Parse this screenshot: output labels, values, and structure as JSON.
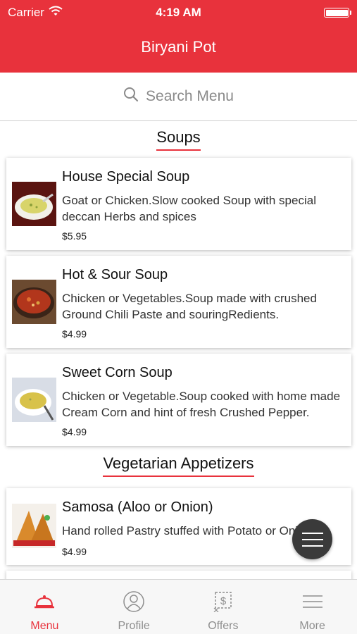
{
  "status_bar": {
    "carrier": "Carrier",
    "time": "4:19 AM"
  },
  "header": {
    "title": "Biryani Pot",
    "color": "#e8323c"
  },
  "search": {
    "placeholder": "Search Menu",
    "icon": "search-icon"
  },
  "sections": [
    {
      "title": "Soups",
      "items": [
        {
          "name": "House Special Soup",
          "description": "Goat or Chicken.Slow cooked Soup with special deccan Herbs and spices",
          "price": "$5.95"
        },
        {
          "name": "Hot & Sour Soup",
          "description": "Chicken or Vegetables.Soup made with crushed Ground Chili Paste and souringRedients.",
          "price": "$4.99"
        },
        {
          "name": "Sweet Corn Soup",
          "description": "Chicken or Vegetable.Soup cooked with home made Cream Corn and hint of fresh Crushed Pepper.",
          "price": "$4.99"
        }
      ]
    },
    {
      "title": "Vegetarian Appetizers",
      "items": [
        {
          "name": "Samosa (Aloo or Onion)",
          "description": "Hand rolled Pastry stuffed with Potato or Onion",
          "price": "$4.99"
        }
      ]
    }
  ],
  "fab": {
    "icon": "menu-icon"
  },
  "tabs": [
    {
      "label": "Menu",
      "icon": "cloche-icon",
      "active": true
    },
    {
      "label": "Profile",
      "icon": "profile-icon",
      "active": false
    },
    {
      "label": "Offers",
      "icon": "offers-icon",
      "active": false
    },
    {
      "label": "More",
      "icon": "more-icon",
      "active": false
    }
  ]
}
